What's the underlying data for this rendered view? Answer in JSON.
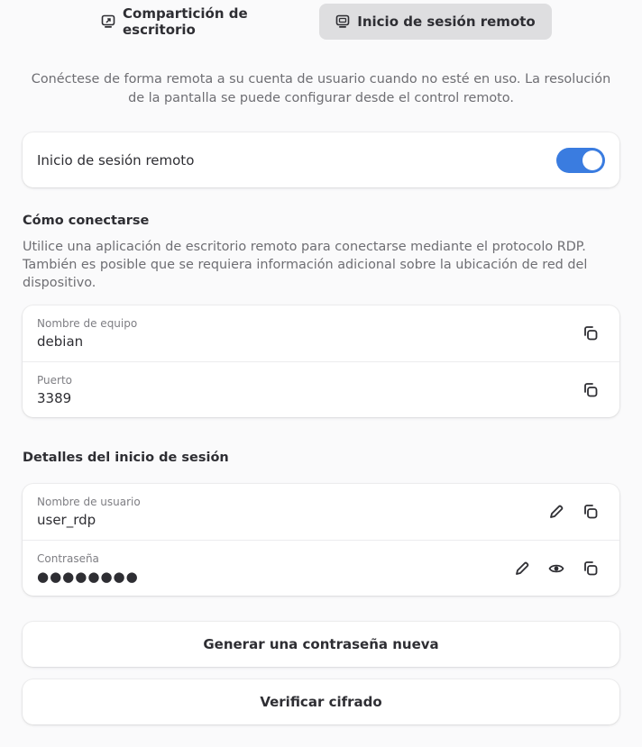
{
  "tabs": [
    {
      "label": "Compartición de escritorio",
      "icon": "desktop-share-icon",
      "selected": false
    },
    {
      "label": "Inicio de sesión remoto",
      "icon": "remote-login-icon",
      "selected": true
    }
  ],
  "intro": "Conéctese de forma remota a su cuenta de usuario cuando no esté en uso. La resolución de la pantalla se puede configurar desde el control remoto.",
  "remote_login": {
    "label": "Inicio de sesión remoto",
    "enabled": true
  },
  "how_to_connect": {
    "title": "Cómo conectarse",
    "description": "Utilice una aplicación de escritorio remoto para conectarse mediante el protocolo RDP. También es posible que se requiera información adicional sobre la ubicación de red del dispositivo.",
    "hostname": {
      "label": "Nombre de equipo",
      "value": "debian"
    },
    "port": {
      "label": "Puerto",
      "value": "3389"
    }
  },
  "login_details": {
    "title": "Detalles del inicio de sesión",
    "username": {
      "label": "Nombre de usuario",
      "value": "user_rdp"
    },
    "password": {
      "label": "Contraseña",
      "value": "●●●●●●●●"
    }
  },
  "buttons": {
    "generate_password": "Generar una contraseña nueva",
    "verify_encryption": "Verificar cifrado"
  },
  "colors": {
    "accent": "#3a7ce0",
    "selected_tab": "#dedee0"
  }
}
